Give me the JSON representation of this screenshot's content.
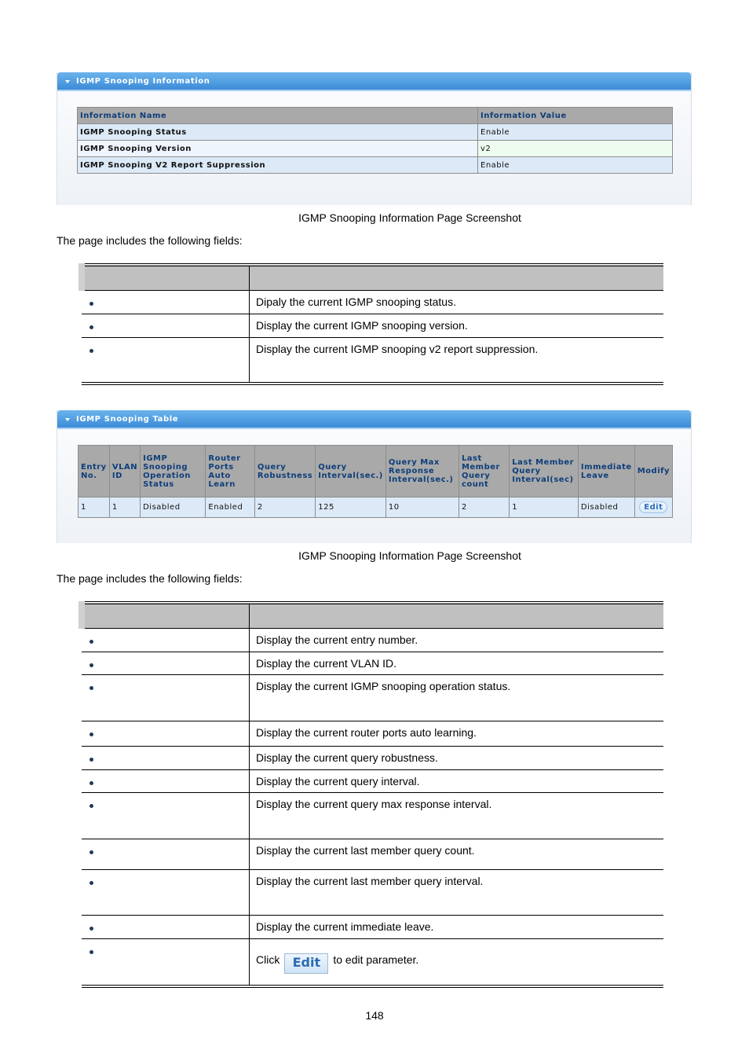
{
  "info_panel": {
    "title": "IGMP Snooping Information",
    "columns": [
      "Information Name",
      "Information Value"
    ],
    "rows": [
      {
        "name": "IGMP Snooping Status",
        "value": "Enable"
      },
      {
        "name": "IGMP Snooping Version",
        "value": "v2"
      },
      {
        "name": "IGMP Snooping V2 Report Suppression",
        "value": "Enable"
      }
    ]
  },
  "caption1": "IGMP Snooping Information Page Screenshot",
  "intro1": "The page includes the following fields:",
  "fields1": [
    {
      "description": "Dipaly the current IGMP snooping status."
    },
    {
      "description": "Display the current IGMP snooping version."
    },
    {
      "description": "Display the current IGMP snooping v2 report suppression."
    }
  ],
  "table_panel": {
    "title": "IGMP Snooping Table",
    "columns": [
      "Entry No.",
      "VLAN ID",
      "IGMP Snooping Operation Status",
      "Router Ports Auto Learn",
      "Query Robustness",
      "Query Interval(sec.)",
      "Query Max Response Interval(sec.)",
      "Last Member Query count",
      "Last Member Query Interval(sec)",
      "Immediate Leave",
      "Modify"
    ],
    "row": {
      "entry_no": "1",
      "vlan_id": "1",
      "operation_status": "Disabled",
      "router_ports_auto_learn": "Enabled",
      "query_robustness": "2",
      "query_interval": "125",
      "query_max_response_interval": "10",
      "last_member_query_count": "2",
      "last_member_query_interval": "1",
      "immediate_leave": "Disabled",
      "modify_label": "Edit"
    }
  },
  "caption2": "IGMP Snooping Information Page Screenshot",
  "intro2": "The page includes the following fields:",
  "fields2": [
    {
      "description": "Display the current entry number."
    },
    {
      "description": "Display the current VLAN ID."
    },
    {
      "description": "Display the current IGMP snooping operation status."
    },
    {
      "description": "Display the current router ports auto learning."
    },
    {
      "description": "Display the current query robustness."
    },
    {
      "description": "Display the current query interval."
    },
    {
      "description": "Display the current query max response interval."
    },
    {
      "description": "Display the current last member query count."
    },
    {
      "description": "Display the current last member query interval."
    },
    {
      "description": "Display the current immediate leave."
    },
    {
      "description_prefix": "Click",
      "button_label": "Edit",
      "description_suffix": "to edit parameter."
    }
  ],
  "page_number": "148"
}
